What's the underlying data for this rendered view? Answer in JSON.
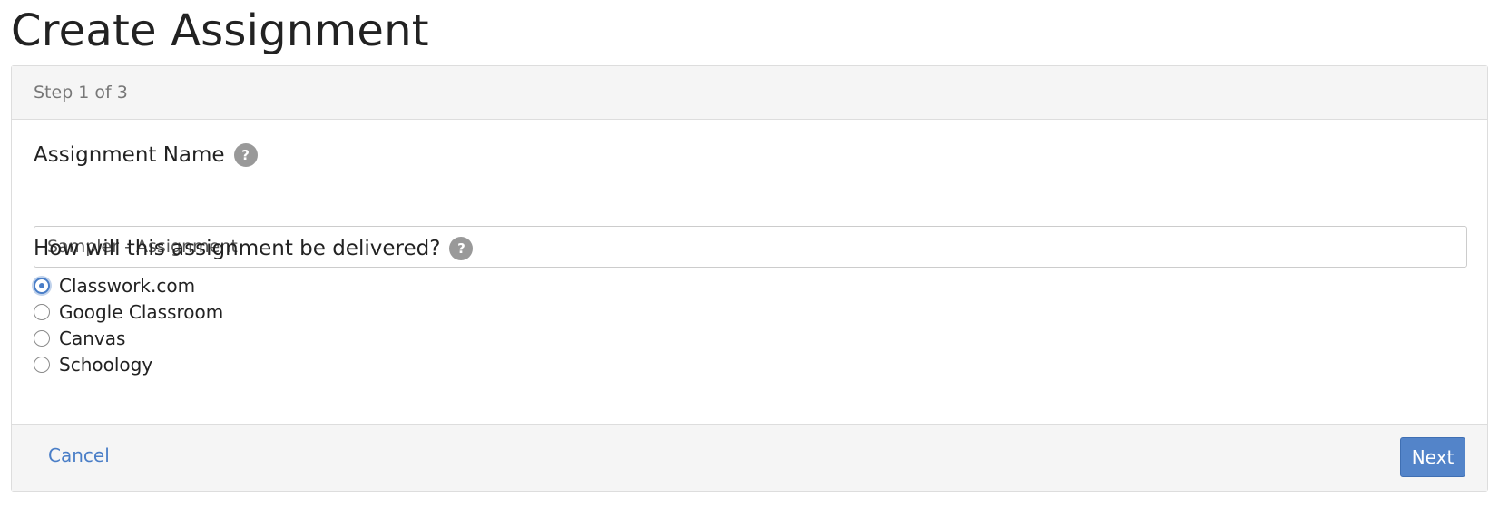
{
  "page": {
    "title": "Create Assignment"
  },
  "wizard": {
    "step_text": "Step 1 of 3"
  },
  "assignment_name": {
    "label": "Assignment Name",
    "help_icon": "?",
    "value": "Sampler - Assignment"
  },
  "delivery": {
    "label": "How will this assignment be delivered?",
    "help_icon": "?",
    "options": [
      {
        "label": "Classwork.com",
        "selected": true
      },
      {
        "label": "Google Classroom",
        "selected": false
      },
      {
        "label": "Canvas",
        "selected": false
      },
      {
        "label": "Schoology",
        "selected": false
      }
    ]
  },
  "footer": {
    "cancel_label": "Cancel",
    "next_label": "Next"
  },
  "colors": {
    "accent": "#5384c9",
    "link": "#4a7ec7",
    "panel_bg": "#f5f5f5",
    "help_icon_bg": "#999999"
  }
}
